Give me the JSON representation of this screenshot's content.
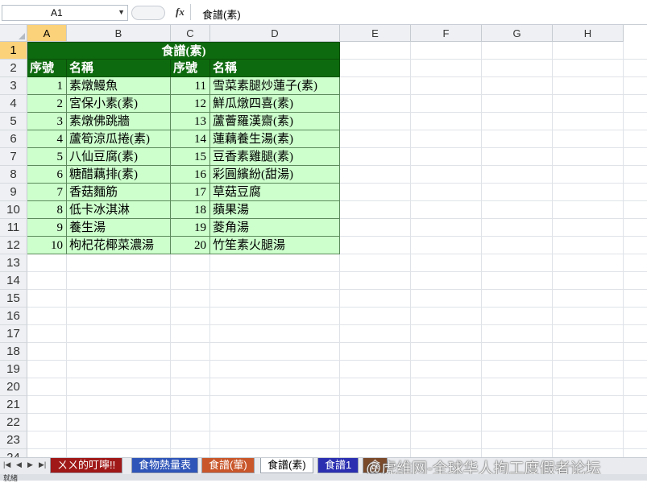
{
  "formula_bar": {
    "name_box": "A1",
    "fx_label": "fx",
    "formula": "食譜(素)"
  },
  "columns": [
    "A",
    "B",
    "C",
    "D",
    "E",
    "F",
    "G",
    "H"
  ],
  "rows": [
    "1",
    "2",
    "3",
    "4",
    "5",
    "6",
    "7",
    "8",
    "9",
    "10",
    "11",
    "12",
    "13",
    "14",
    "15",
    "16",
    "17",
    "18",
    "19",
    "20",
    "21",
    "22",
    "23",
    "24"
  ],
  "sheet": {
    "title": "食譜(素)",
    "headers": {
      "seq1": "序號",
      "name1": "名稱",
      "seq2": "序號",
      "name2": "名稱"
    },
    "items": [
      {
        "seq1": "1",
        "name1": "素燉鰻魚",
        "seq2": "11",
        "name2": "雪菜素腿炒蓮子(素)"
      },
      {
        "seq1": "2",
        "name1": "宮保小素(素)",
        "seq2": "12",
        "name2": "鮮瓜燉四喜(素)"
      },
      {
        "seq1": "3",
        "name1": "素燉佛跳牆",
        "seq2": "13",
        "name2": "蘆薈羅漢齋(素)"
      },
      {
        "seq1": "4",
        "name1": "蘆筍涼瓜捲(素)",
        "seq2": "14",
        "name2": "蓮藕養生湯(素)"
      },
      {
        "seq1": "5",
        "name1": "八仙豆腐(素)",
        "seq2": "15",
        "name2": "豆香素雞腿(素)"
      },
      {
        "seq1": "6",
        "name1": "糖醋藕排(素)",
        "seq2": "16",
        "name2": "彩圓繽紛(甜湯)"
      },
      {
        "seq1": "7",
        "name1": "香菇麵筋",
        "seq2": "17",
        "name2": "草菇豆腐"
      },
      {
        "seq1": "8",
        "name1": "低卡冰淇淋",
        "seq2": "18",
        "name2": "蘋果湯"
      },
      {
        "seq1": "9",
        "name1": "養生湯",
        "seq2": "19",
        "name2": "菱角湯"
      },
      {
        "seq1": "10",
        "name1": "枸杞花椰菜濃湯",
        "seq2": "20",
        "name2": "竹笙素火腿湯"
      }
    ]
  },
  "tabs": [
    {
      "label": "ㄨㄨ的叮嚀!!",
      "style": "t1"
    },
    {
      "label": "食物熱量表",
      "style": "t2"
    },
    {
      "label": "食譜(葷)",
      "style": "t3"
    },
    {
      "label": "食譜(素)",
      "style": "active"
    },
    {
      "label": "食譜1",
      "style": "t4"
    },
    {
      "label": "食",
      "style": "t5"
    }
  ],
  "watermark": "@虎维网-全球华人拘工度假者论坛",
  "status_text": "就緒",
  "colors": {
    "header_green": "#0e6a0e",
    "cell_green": "#ccffcc",
    "selection_orange": "#fbd27a"
  }
}
